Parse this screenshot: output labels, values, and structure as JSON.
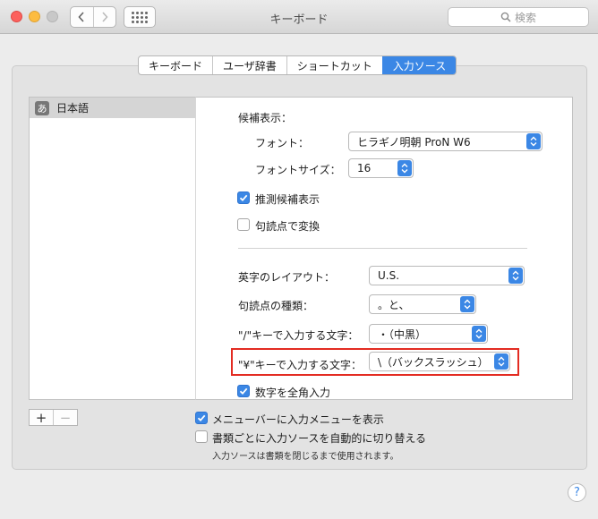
{
  "window": {
    "title": "キーボード"
  },
  "toolbar": {
    "search_placeholder": "検索"
  },
  "tabs": [
    {
      "label": "キーボード",
      "active": false
    },
    {
      "label": "ユーザ辞書",
      "active": false
    },
    {
      "label": "ショートカット",
      "active": false
    },
    {
      "label": "入力ソース",
      "active": true
    }
  ],
  "source_list": {
    "items": [
      {
        "icon_char": "あ",
        "label": "日本語",
        "selected": true
      }
    ]
  },
  "settings": {
    "candidates_heading": "候補表示：",
    "font_label": "フォント：",
    "font_value": "ヒラギノ明朝 ProN W6",
    "font_size_label": "フォントサイズ：",
    "font_size_value": "16",
    "predictive_label": "推測候補表示",
    "predictive_checked": true,
    "punct_convert_label": "句読点で変換",
    "punct_convert_checked": false,
    "layout_label": "英字のレイアウト：",
    "layout_value": "U.S.",
    "punct_type_label": "句読点の種類：",
    "punct_type_value": "。と、",
    "slash_label": "\"/\"キーで入力する文字：",
    "slash_value": "・（中黒）",
    "yen_label": "\"¥\"キーで入力する文字：",
    "yen_value": "\\（バックスラッシュ）",
    "fullwidth_label": "数字を全角入力",
    "fullwidth_checked": true
  },
  "bottom": {
    "add_label": "+",
    "remove_label": "−",
    "show_menu_label": "メニューバーに入力メニューを表示",
    "show_menu_checked": true,
    "auto_switch_label": "書類ごとに入力ソースを自動的に切り替える",
    "auto_switch_checked": false,
    "note": "入力ソースは書類を閉じるまで使用されます。",
    "help_label": "?"
  },
  "colors": {
    "accent": "#3b87e5",
    "highlight_border": "#e32c22"
  }
}
